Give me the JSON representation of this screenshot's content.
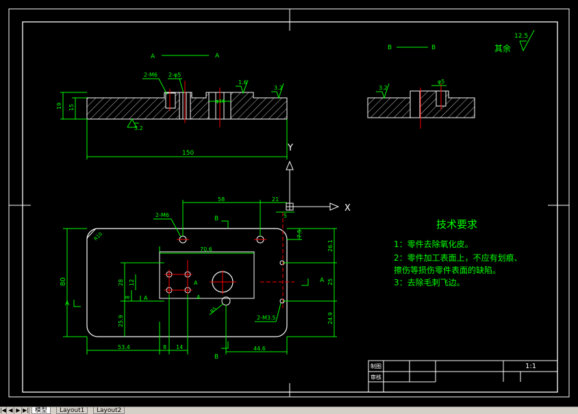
{
  "colors": {
    "background": "#000000",
    "outline": "#ffffff",
    "dimension": "#00ff00",
    "center": "#ff0000",
    "hatch": "#ffffff",
    "text_green": "#00ff00",
    "text_white": "#ffffff",
    "tabbar": "#d4d0c8"
  },
  "section_labels": {
    "aa_left": "A",
    "aa_right": "A",
    "bb_left": "B",
    "bb_right": "B",
    "plan_a_left": "A",
    "plan_a_right": "A",
    "plan_b_top": "B",
    "plan_b_bottom": "B"
  },
  "roughness": {
    "other_label": "其余",
    "other_value": "12.5",
    "r1": "3.2",
    "r2": "1.6",
    "r3": "3.2",
    "r4": "3.2"
  },
  "dims_section_a": {
    "m6": "2-M6",
    "d5": "2-φ5",
    "h19": "19",
    "h15": "15",
    "d16": "φ16",
    "len150": "150"
  },
  "dims_section_b": {
    "d5": "φ5"
  },
  "dims_plan": {
    "d58": "58",
    "d21": "21",
    "d5": "5",
    "m6": "2-M6",
    "r10": "R10",
    "d70_6": "70.6",
    "d80": "80",
    "d28": "28",
    "d12": "12",
    "d8v": "8",
    "d25_9": "25.9",
    "d53_4": "53.4",
    "d8h": "8",
    "d14": "14",
    "d44_6": "44.6",
    "r5": "R5",
    "m3_5": "2-M3.5",
    "d7_5": "7.5",
    "d26_1": "26.1",
    "d25": "25",
    "d24_9": "24.9"
  },
  "ucs": {
    "x": "X",
    "y": "Y"
  },
  "tech_req": {
    "title": "技术要求",
    "line1": "1：零件去除氧化皮。",
    "line2": "2：零件加工表面上，不应有划痕、",
    "line3": "擦伤等损伤零件表面的缺陷。",
    "line4": "3：去除毛刺飞边。"
  },
  "title_block": {
    "scale": "1:1",
    "label1": "制图",
    "label2": "审核"
  },
  "tabs": {
    "model": "模型",
    "layout1": "Layout1",
    "layout2": "Layout2"
  },
  "nav": {
    "first": "|◀",
    "prev": "◀",
    "next": "▶",
    "last": "▶|"
  }
}
